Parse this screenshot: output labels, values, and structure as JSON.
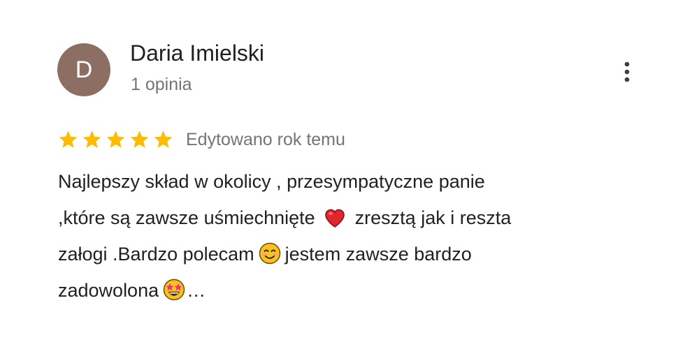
{
  "review": {
    "author": {
      "initial": "D",
      "name": "Daria Imielski",
      "meta": "1 opinia",
      "avatar_color": "#8d6e63"
    },
    "more_icon": "more-vert-icon",
    "rating": {
      "stars": 5,
      "max": 5,
      "star_color": "#fbbc04",
      "edited_label": "Edytowano rok temu"
    },
    "text_lines": {
      "line1": "Najlepszy skład w okolicy , przesympatyczne panie",
      "line2_a": ",które są zawsze uśmiechnięte ",
      "line2_b": " zresztą jak i reszta",
      "line3_a": "załogi .Bardzo polecam",
      "line3_b": "jestem zawsze bardzo",
      "line4_a": "zadowolona",
      "line4_b": "…"
    },
    "emojis": [
      "red-heart-emoji",
      "smiling-face-emoji",
      "star-struck-emoji"
    ]
  }
}
